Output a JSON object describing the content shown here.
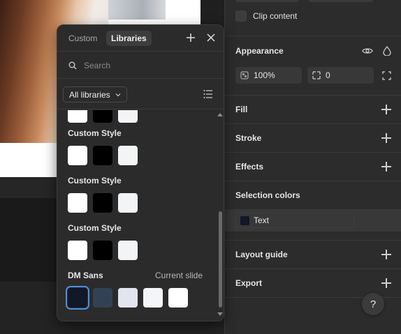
{
  "popover": {
    "tabs": [
      {
        "label": "Custom",
        "active": false
      },
      {
        "label": "Libraries",
        "active": true
      }
    ],
    "add_icon": "plus-icon",
    "close_icon": "close-icon",
    "search": {
      "placeholder": "Search",
      "value": ""
    },
    "library_filter": {
      "label": "All libraries",
      "icon": "chevron-down-icon"
    },
    "view_toggle_icon": "list-view-icon",
    "groups": [
      {
        "title": "",
        "swatches": [
          "#ffffff",
          "#000000",
          "#f3f4f6"
        ]
      },
      {
        "title": "Custom Style",
        "swatches": [
          "#ffffff",
          "#000000",
          "#f3f4f6"
        ]
      },
      {
        "title": "Custom Style",
        "swatches": [
          "#ffffff",
          "#000000",
          "#f3f4f6"
        ]
      },
      {
        "title": "Custom Style",
        "swatches": [
          "#ffffff",
          "#000000",
          "#f3f4f6"
        ]
      },
      {
        "title": "DM Sans",
        "right_label": "Current slide",
        "swatches": [
          "#111827",
          "#334155",
          "#e2e4ee",
          "#f3f5f8",
          "#ffffff"
        ],
        "selected_index": 0
      }
    ]
  },
  "properties": {
    "clip_content_label": "Clip content",
    "appearance": {
      "title": "Appearance",
      "opacity": "100%",
      "corner_radius": "0"
    },
    "sections": {
      "fill": "Fill",
      "stroke": "Stroke",
      "effects": "Effects",
      "selection_colors": "Selection colors",
      "layout_guide": "Layout guide",
      "export": "Export"
    },
    "selection_color": {
      "label": "Text",
      "color": "#111827"
    },
    "help_label": "?"
  },
  "colors": {
    "panel_bg": "#2c2c2c",
    "selection_accent": "#4d8fe0"
  }
}
